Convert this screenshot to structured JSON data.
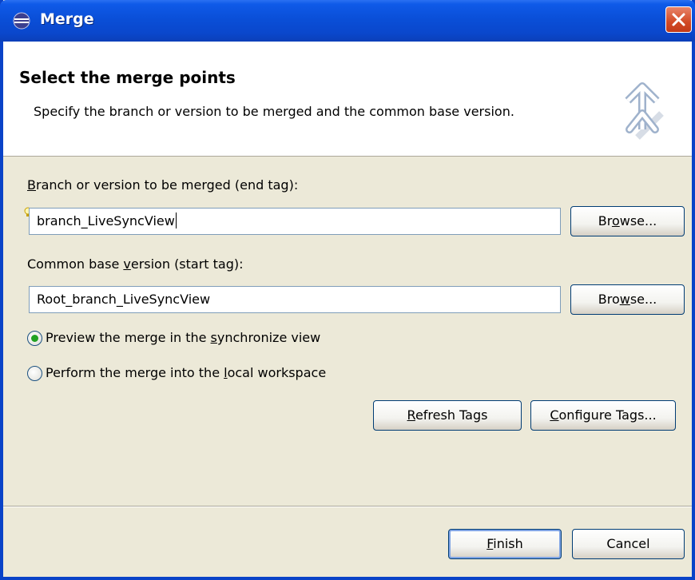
{
  "window": {
    "title": "Merge"
  },
  "header": {
    "title": "Select the merge points",
    "description": "Specify the branch or version to be merged and the common base version."
  },
  "end_tag": {
    "label_key": "B",
    "label_rest": "ranch or version to be merged (end tag):",
    "value": "branch_LiveSyncView",
    "browse": {
      "pre": "Br",
      "key": "o",
      "post": "wse..."
    }
  },
  "start_tag": {
    "label_pre": "Common base ",
    "label_key": "v",
    "label_post": "ersion (start tag):",
    "value": "Root_branch_LiveSyncView",
    "browse": {
      "pre": "Bro",
      "key": "w",
      "post": "se..."
    }
  },
  "options": [
    {
      "pre": "Preview the merge in the ",
      "key": "s",
      "post": "ynchronize view",
      "selected": true
    },
    {
      "pre": "Perform the merge into the ",
      "key": "l",
      "post": "ocal workspace",
      "selected": false
    }
  ],
  "tag_buttons": {
    "refresh": {
      "key": "R",
      "post": "efresh Tags"
    },
    "configure": {
      "key": "C",
      "post": "onfigure Tags..."
    }
  },
  "footer": {
    "finish": {
      "key": "F",
      "post": "inish"
    },
    "cancel": "Cancel"
  },
  "colors": {
    "titlebar": "#0a4fd8",
    "dialog_bg": "#ece9d8",
    "radio_dot": "#21a121",
    "close": "#d24a25"
  }
}
